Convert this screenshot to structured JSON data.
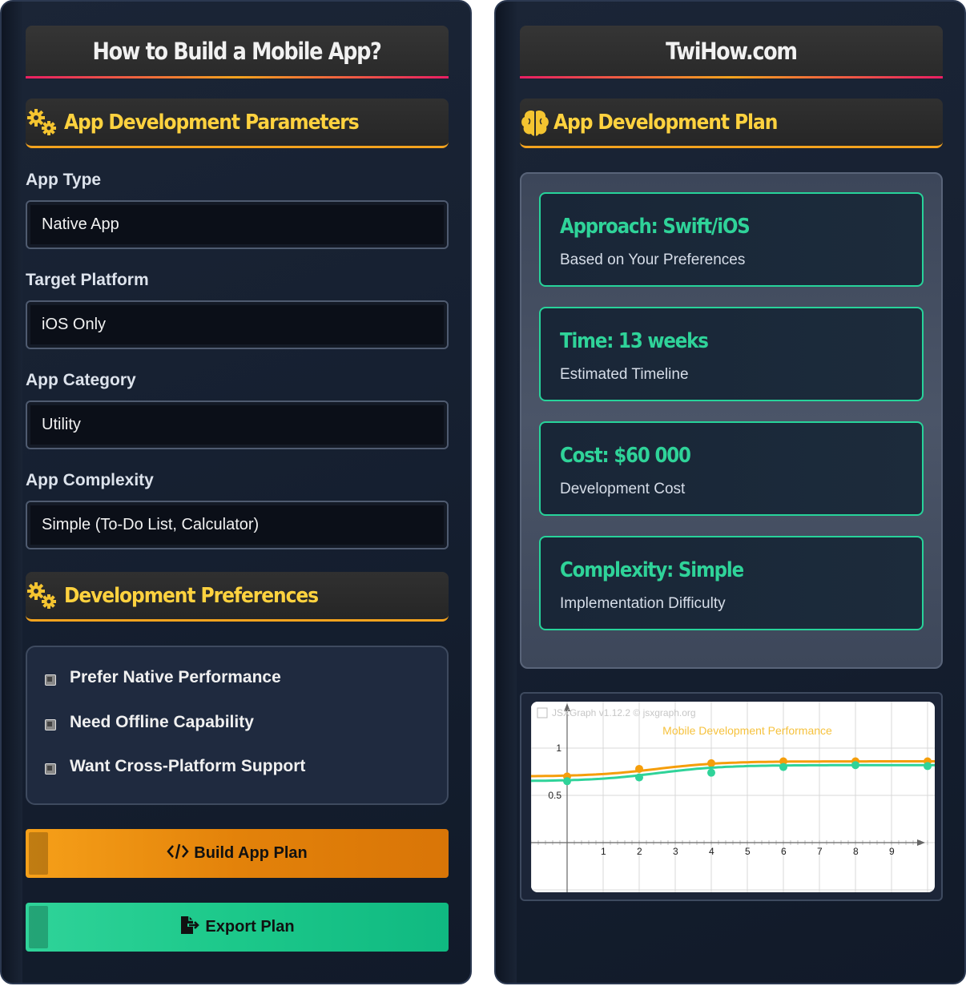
{
  "left": {
    "title": "How to Build a Mobile App?",
    "params_header": "App Development Parameters",
    "fields": [
      {
        "label": "App Type",
        "value": "Native App"
      },
      {
        "label": "Target Platform",
        "value": "iOS Only"
      },
      {
        "label": "App Category",
        "value": "Utility"
      },
      {
        "label": "App Complexity",
        "value": "Simple (To-Do List, Calculator)"
      }
    ],
    "prefs_header": "Development Preferences",
    "preferences": [
      "Prefer Native Performance",
      "Need Offline Capability",
      "Want Cross-Platform Support"
    ],
    "build_button": "Build App Plan",
    "export_button": "Export Plan"
  },
  "right": {
    "title": "TwiHow.com",
    "plan_header": "App Development Plan",
    "cards": [
      {
        "value": "Approach: Swift/iOS",
        "caption": "Based on Your Preferences"
      },
      {
        "value": "Time: 13 weeks",
        "caption": "Estimated Timeline"
      },
      {
        "value": "Cost: $60 000",
        "caption": "Development Cost"
      },
      {
        "value": "Complexity: Simple",
        "caption": "Implementation Difficulty"
      }
    ]
  },
  "icons": {
    "params": "gears-icon",
    "prefs": "gears-icon",
    "plan": "brain-icon",
    "build": "code-icon",
    "export": "file-export-icon"
  },
  "colors": {
    "accent_gold": "#ffd23f",
    "accent_green": "#2fd399",
    "orange_button": "#f4a31e",
    "green_button": "#10b981"
  },
  "chart_data": {
    "type": "line",
    "title": "Mobile Development Performance",
    "watermark": "JSXGraph v1.12.2 © jsxgraph.org",
    "xlim": [
      -1,
      10
    ],
    "ylim": [
      -0.5,
      1.5
    ],
    "x_ticks": [
      "1",
      "2",
      "3",
      "4",
      "5",
      "6",
      "7",
      "8",
      "9"
    ],
    "y_ticks": [
      "0.5",
      "1"
    ],
    "grid": true,
    "series": [
      {
        "color": "#f59e0b",
        "x": [
          0,
          2,
          4,
          6,
          8,
          10
        ],
        "y": [
          0.7,
          0.78,
          0.84,
          0.86,
          0.86,
          0.86
        ]
      },
      {
        "color": "#2fd399",
        "x": [
          0,
          2,
          4,
          6,
          8,
          10
        ],
        "y": [
          0.65,
          0.69,
          0.74,
          0.8,
          0.82,
          0.81
        ]
      }
    ]
  }
}
